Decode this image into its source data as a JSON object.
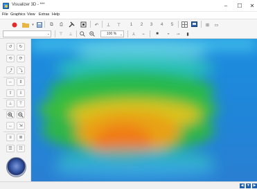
{
  "window": {
    "title": "Visualizer 3D - ***",
    "controls": {
      "minimize": "–",
      "maximize": "☐",
      "close": "✕"
    }
  },
  "menu": [
    "File",
    "Graphics",
    "View",
    "Extras",
    "Help"
  ],
  "toolbar1": {
    "step_labels": [
      "1",
      "2",
      "3",
      "4",
      "5"
    ]
  },
  "toolbar2": {
    "primary_selection": "",
    "zoom_value": "100 %"
  },
  "statusbar": {
    "nav_buttons": [
      "◀",
      "▼",
      "▶"
    ]
  },
  "colors": {
    "record_red": "#e22b2b",
    "accent_blue": "#1f5fb0",
    "heatmap_low": "#1d8fe0",
    "heatmap_mid": "#2fb54a",
    "heatmap_high": "#f07a12"
  }
}
